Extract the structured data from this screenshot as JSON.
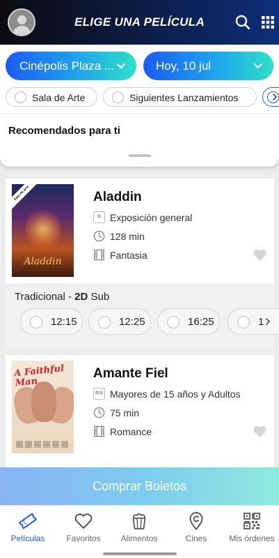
{
  "header": {
    "title": "ELIGE UNA PELÍCULA"
  },
  "filters": {
    "cinema": "Cinépolis Plaza ...",
    "date": "Hoy, 10 jul",
    "chips": [
      {
        "label": "Sala de Arte",
        "selected": false
      },
      {
        "label": "Siguientes Lanzamientos",
        "selected": false
      }
    ]
  },
  "section": {
    "title": "Recomendados para ti"
  },
  "movies": [
    {
      "title": "Aladdin",
      "poster_title": "Aladdin",
      "poster_badge": "Sala de arte",
      "rating_code": "G",
      "rating": "Exposición general",
      "duration": "128 min",
      "genre": "Fantasia",
      "favorite": false,
      "format_prefix": "Tradicional - ",
      "format_bold": "2D",
      "format_suffix": " Sub",
      "showtimes": [
        "12:15",
        "12:25",
        "16:25",
        "1"
      ]
    },
    {
      "title": "Amante Fiel",
      "poster_title": "A Faithful Man",
      "rating_code": "B15",
      "rating": "Mayores de 15 años  y Adultos",
      "duration": "75 min",
      "genre": "Romance",
      "favorite": false
    }
  ],
  "actions": {
    "buy": "Comprar Boletos"
  },
  "nav": [
    {
      "label": "Películas",
      "icon": "ticket-icon",
      "active": true
    },
    {
      "label": "Favoritos",
      "icon": "heart-icon",
      "active": false
    },
    {
      "label": "Alimentos",
      "icon": "popcorn-icon",
      "active": false
    },
    {
      "label": "Cines",
      "icon": "location-pin-icon",
      "active": false
    },
    {
      "label": "Mis órdenes",
      "icon": "qr-code-icon",
      "active": false
    }
  ],
  "colors": {
    "accent": "#1a5cf2",
    "gradient_end": "#2de0c8",
    "header_bg": "#0d1a3f"
  }
}
